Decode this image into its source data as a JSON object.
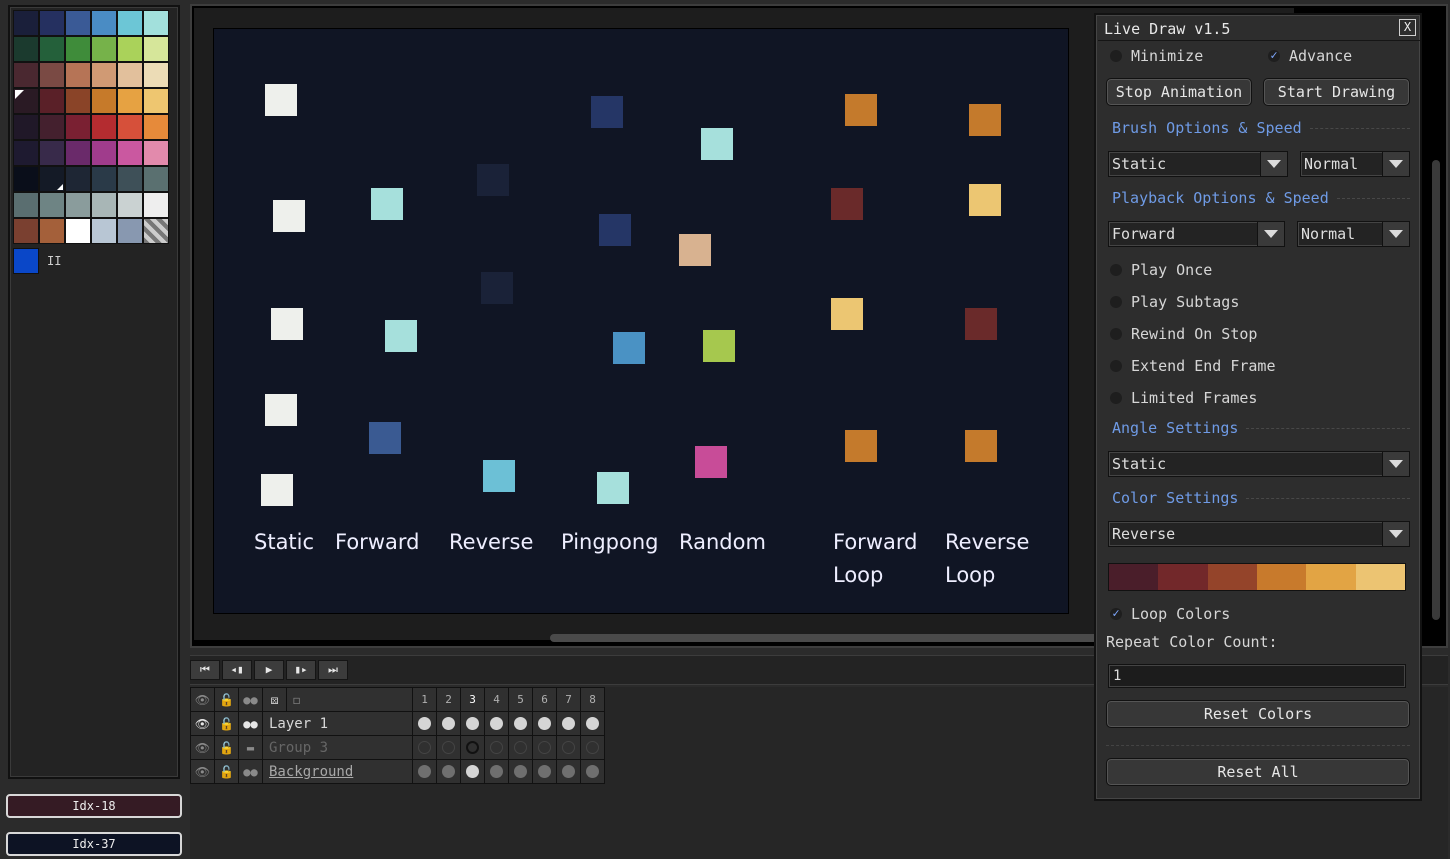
{
  "palette": {
    "swatches": [
      "#1a1f3a",
      "#253060",
      "#3a5a96",
      "#4a8cc4",
      "#6cc6d6",
      "#a2e0dc",
      "#1b3a2e",
      "#24603a",
      "#3f8c3a",
      "#76b24a",
      "#aad25a",
      "#d6e69a",
      "#4a2830",
      "#7a4a44",
      "#b67456",
      "#d09a74",
      "#e2c09c",
      "#ecdcb6",
      "#2a1a24",
      "#5a2028",
      "#8a4428",
      "#c67a2a",
      "#e6a242",
      "#eec670",
      "#201828",
      "#44202e",
      "#7a2032",
      "#b42c30",
      "#d6503a",
      "#e68a3a",
      "#1e1a30",
      "#382a4a",
      "#6a2a6a",
      "#a03c8c",
      "#ca58a0",
      "#e28aac",
      "#0a0e1a",
      "#141a26",
      "#1e2634",
      "#2a3a48",
      "#3e5058",
      "#5a7070",
      "#5a6e70",
      "#6e8484",
      "#8a9c9c",
      "#a8b6b6",
      "#cad2d2",
      "#eeeeee",
      "#7a4030",
      "#a4603a",
      "#ffffff",
      "#b8c6d4",
      "#8898b0",
      "mask"
    ],
    "extra_color": "#0a47c8",
    "pause_glyph": "II"
  },
  "index_boxes": [
    {
      "label": "Idx-18",
      "color": "#351b24"
    },
    {
      "label": "Idx-37",
      "color": "#0d1324"
    }
  ],
  "canvas": {
    "background": "#101524",
    "labels": [
      "Static",
      "Forward",
      "Reverse",
      "Pingpong",
      "Random",
      "Forward\nLoop",
      "Reverse\nLoop"
    ],
    "squares": [
      "#eef0ec",
      "#eef0ec",
      "#eef0ec",
      "#eef0ec",
      "#eef0ec",
      "#a6e0dc",
      "#a6e0dc",
      "#3a5a92",
      "#6cc0d6",
      "#1a2238",
      "#1a2238",
      "#253666",
      "#253666",
      "#4a92c4",
      "#a6e0dc",
      "#a6e0dc",
      "#d8b290",
      "#a6c84e",
      "#c84c98",
      "#c47a2c",
      "#6a2a2a",
      "#ecc672",
      "#c47a2c",
      "#c47a2c",
      "#ecc672",
      "#6a2a2a",
      "#c47a2c"
    ]
  },
  "timeline": {
    "buttons": [
      "⏮",
      "◂▮",
      "▶",
      "▮▸",
      "⏭"
    ],
    "frame_numbers": [
      "1",
      "2",
      "3",
      "4",
      "5",
      "6",
      "7",
      "8"
    ],
    "layers": [
      {
        "name": "Layer 1"
      },
      {
        "name": "Group 3"
      },
      {
        "name": "Background"
      }
    ]
  },
  "dialog": {
    "title": "Live Draw v1.5",
    "close": "X",
    "minimize": {
      "label": "Minimize",
      "checked": false
    },
    "advance": {
      "label": "Advance",
      "checked": true
    },
    "stop_animation": "Stop Animation",
    "start_drawing": "Start Drawing",
    "brush_section": "Brush Options & Speed",
    "brush_mode": "Static",
    "brush_speed": "Normal",
    "playback_section": "Playback Options & Speed",
    "playback_mode": "Forward",
    "playback_speed": "Normal",
    "options": [
      {
        "label": "Play Once",
        "checked": false
      },
      {
        "label": "Play Subtags",
        "checked": false
      },
      {
        "label": "Rewind On Stop",
        "checked": false
      },
      {
        "label": "Extend End Frame",
        "checked": false
      },
      {
        "label": "Limited Frames",
        "checked": false
      }
    ],
    "angle_section": "Angle Settings",
    "angle_mode": "Static",
    "color_section": "Color Settings",
    "color_mode": "Reverse",
    "color_strip": [
      "#4a1e2a",
      "#72282a",
      "#94442a",
      "#c87a2c",
      "#e2a444",
      "#ecc472"
    ],
    "loop_colors": {
      "label": "Loop Colors",
      "checked": true
    },
    "repeat_label": "Repeat Color Count:",
    "repeat_value": "1",
    "reset_colors": "Reset Colors",
    "reset_all": "Reset All",
    "check_glyph": "✓"
  }
}
